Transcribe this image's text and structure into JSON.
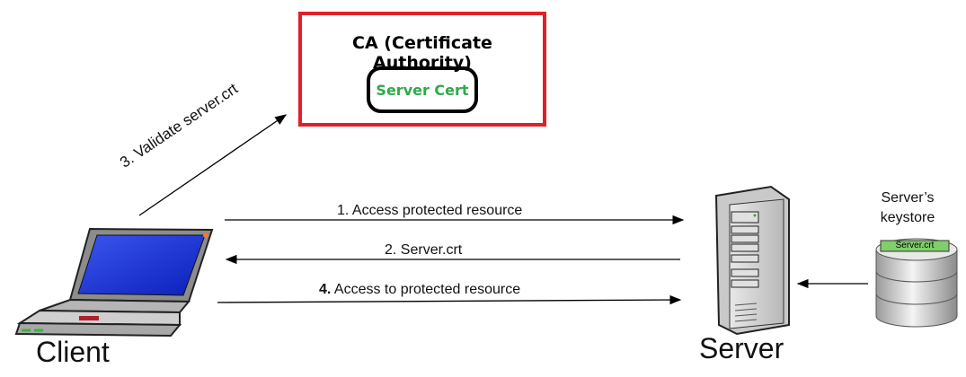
{
  "ca": {
    "title": "CA (Certificate Authority)",
    "cert_label": "Server Cert"
  },
  "arrows": {
    "validate": "3. Validate server.crt",
    "step1": "1.  Access protected resource",
    "step2": "2. Server.crt",
    "step4_num": "4.",
    "step4_text": " Access to protected resource"
  },
  "client": {
    "label": "Client"
  },
  "server": {
    "label": "Server"
  },
  "keystore": {
    "title_line1": "Server’s",
    "title_line2": "keystore",
    "cert_tag": "Server.crt"
  },
  "colors": {
    "ca_border": "#e02028",
    "cert_text": "#2eaa4a",
    "tag_fill": "#7fcf6a"
  }
}
